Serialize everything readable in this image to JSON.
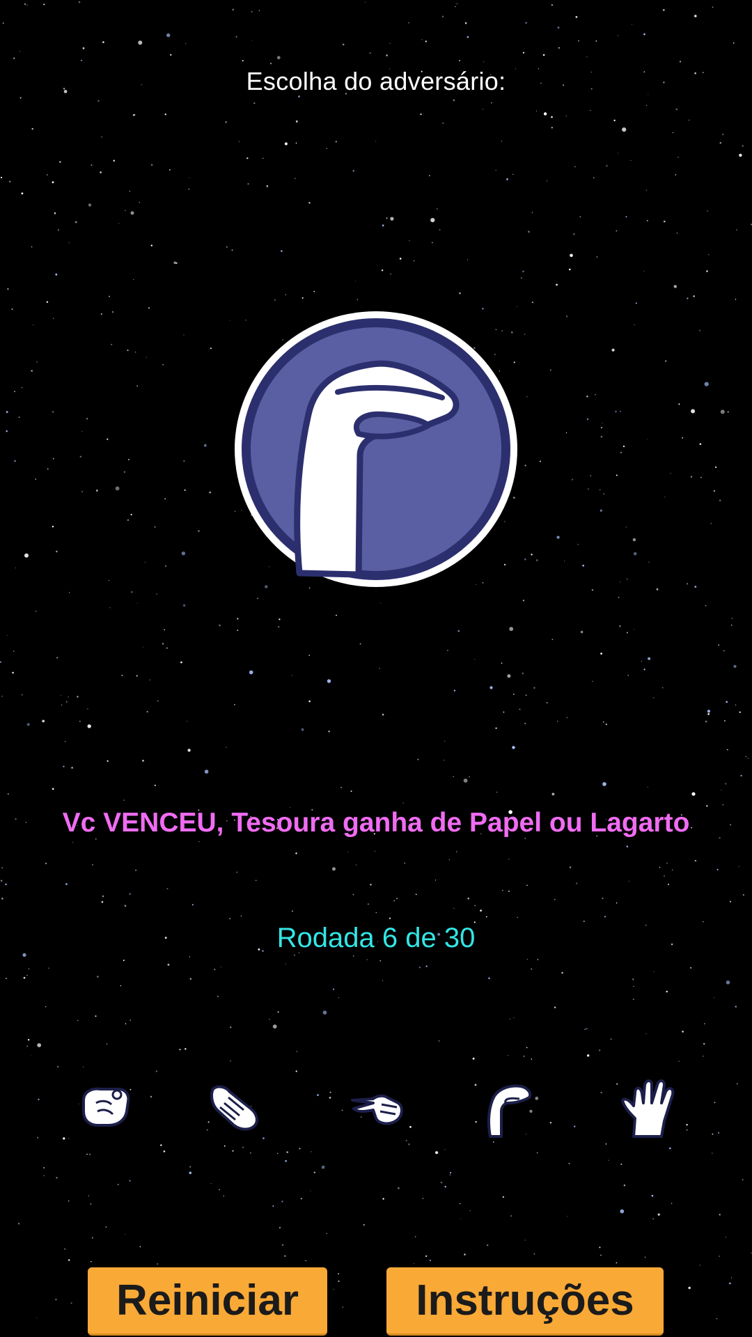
{
  "header": {
    "opponent_label": "Escolha do adversário:"
  },
  "opponent": {
    "choice": "lagarto",
    "icon": "lizard-hand-icon"
  },
  "status": {
    "result": "Vc VENCEU, Tesoura ganha de Papel ou Lagarto",
    "round": "Rodada 6 de 30"
  },
  "choices": [
    {
      "id": "pedra",
      "icon": "rock-fist-icon"
    },
    {
      "id": "papel",
      "icon": "paper-hand-icon"
    },
    {
      "id": "tesoura",
      "icon": "scissors-hand-icon"
    },
    {
      "id": "lagarto",
      "icon": "lizard-hand-icon"
    },
    {
      "id": "spock",
      "icon": "spock-hand-icon"
    }
  ],
  "buttons": {
    "restart_label": "Reiniciar",
    "instructions_label": "Instruções"
  },
  "colors": {
    "background": "#000000",
    "result_text": "#f06cf2",
    "round_text": "#33e6e6",
    "button_bg": "#f9a936",
    "badge_blue": "#5a5fa3",
    "badge_ring": "#2c2f6e"
  }
}
